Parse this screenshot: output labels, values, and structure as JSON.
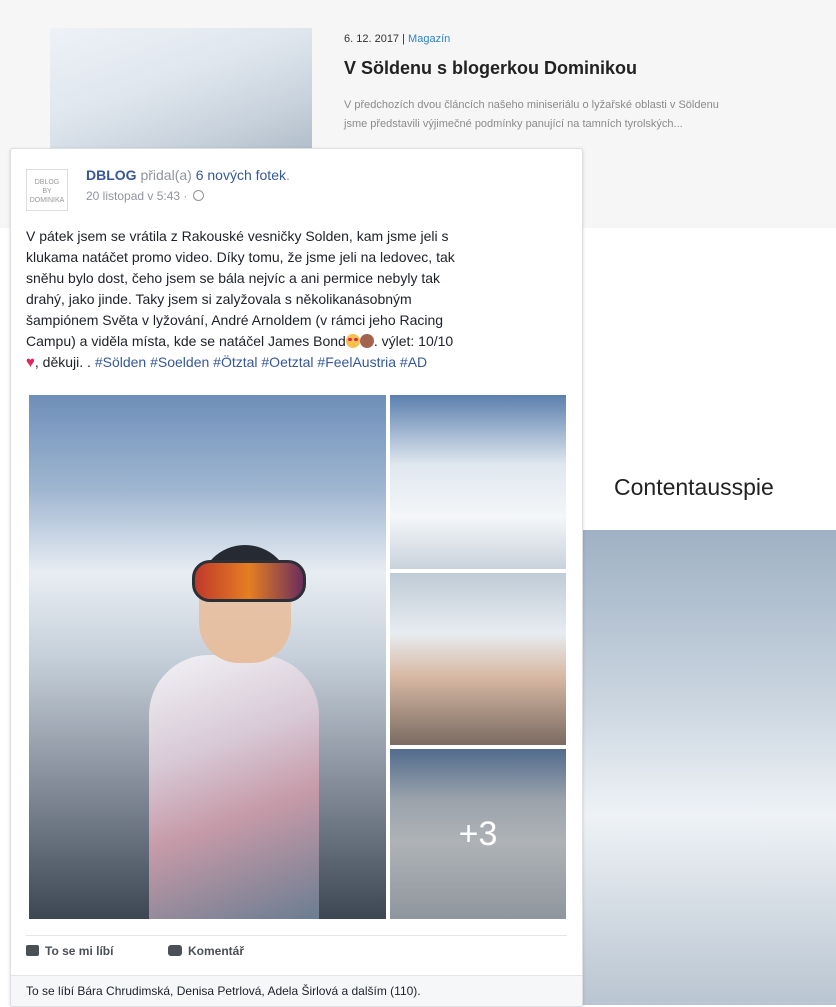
{
  "article": {
    "date": "6. 12. 2017",
    "separator": "|",
    "category": "Magazín",
    "title": "V Söldenu s blogerkou Dominikou",
    "excerpt_line1": "V předchozích dvou článcích našeho miniseriálu o lyžařské oblasti v Söldenu",
    "excerpt_line2": "jsme představili výjimečné podmínky panující na tamních tyrolských..."
  },
  "promo": {
    "heading": "Contentausspie"
  },
  "post": {
    "avatar_lines": [
      "DBLOG",
      "BY",
      "DOMINIKA"
    ],
    "page_name": "DBLOG",
    "added_text": "přidal(a)",
    "photos_link": "6 nových fotek",
    "period": ".",
    "timestamp": "20 listopad v 5:43 ·",
    "text_lines": [
      "V pátek jsem se vrátila z Rakouské vesničky Solden, kam jsme jeli s",
      "klukama natáčet promo video. Díky tomu, že jsme jeli na ledovec, tak",
      "sněhu bylo dost, čeho jsem se bála nejvíc a ani permice nebyly tak",
      "drahý, jako jinde. Taky jsem si zalyžovala s několikanásobným",
      "šampiónem Světa v lyžování, André Arnoldem (v rámci jeho Racing",
      "Campu) a viděla místa, kde se natáčel James Bond"
    ],
    "text_rating": ". výlet: 10/10",
    "text_thanks": ", děkuji. .",
    "hashtags": "#Sölden #Soelden #Ötztal #Oetztal #FeelAustria #AD",
    "more_photos": "+3",
    "like_label": "To se mi líbí",
    "comment_label": "Komentář",
    "likes_summary": "To se líbí Bára Chrudimská, Denisa Petrlová, Adela Širlová a dalším (110)."
  }
}
